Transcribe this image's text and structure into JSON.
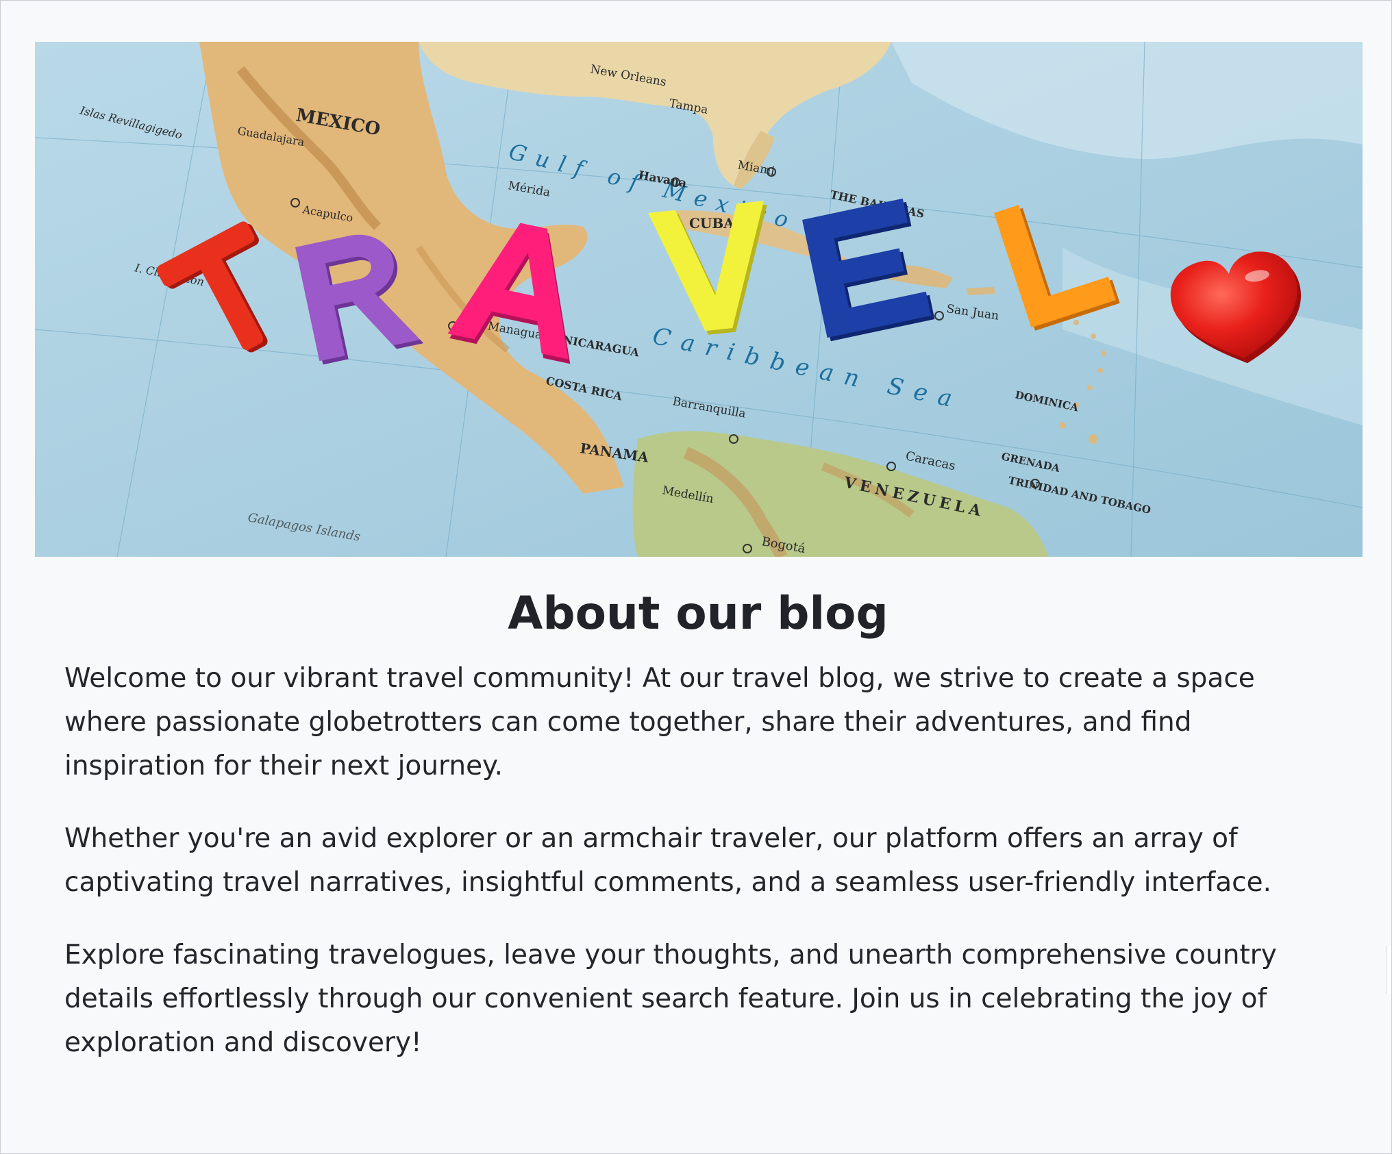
{
  "hero": {
    "image_name": "travel-letters-on-map",
    "letters": [
      "T",
      "R",
      "A",
      "V",
      "E",
      "L"
    ],
    "letter_colors": [
      "#e8301c",
      "#9b59c9",
      "#ff1f7a",
      "#f2f23c",
      "#1c3fa8",
      "#ff9a1a"
    ],
    "heart_color": "#e01a1a",
    "map_labels": {
      "mexico": "MEXICO",
      "gulf": "Gulf of Mexico",
      "caribbean": "Caribbean Sea",
      "venezuela": "VENEZUELA",
      "panama": "PANAMA",
      "cuba": "CUBA",
      "bahamas": "THE BAHAMAS",
      "costa_rica": "COSTA RICA",
      "nicaragua": "NICARAGUA",
      "galapagos": "Galapagos Islands",
      "clipperton": "I. Clipperton",
      "revillagigedo": "Islas Revillagigedo",
      "trinidad": "TRINIDAD AND TOBAGO",
      "grenada": "GRENADA",
      "dominica": "DOMINICA",
      "bogota": "Bogotá",
      "caracas": "Caracas",
      "havana": "Havana",
      "miami": "Miami",
      "tampa": "Tampa",
      "new_orleans": "New Orleans",
      "merida": "Mérida",
      "acapulco": "Acapulco",
      "guadalajara": "Guadalajara",
      "managua": "Managua",
      "san_juan": "San Juan",
      "barranquilla": "Barranquilla",
      "medellin": "Medellín"
    }
  },
  "about": {
    "title": "About our blog",
    "paragraphs": [
      "Welcome to our vibrant travel community! At our travel blog, we strive to create a space where passionate globetrotters can come together, share their adventures, and find inspiration for their next journey.",
      "Whether you're an avid explorer or an armchair traveler, our platform offers an array of captivating travel narratives, insightful comments, and a seamless user-friendly interface.",
      "Explore fascinating travelogues, leave your thoughts, and unearth comprehensive country details effortlessly through our convenient search feature. Join us in celebrating the joy of exploration and discovery!"
    ]
  }
}
